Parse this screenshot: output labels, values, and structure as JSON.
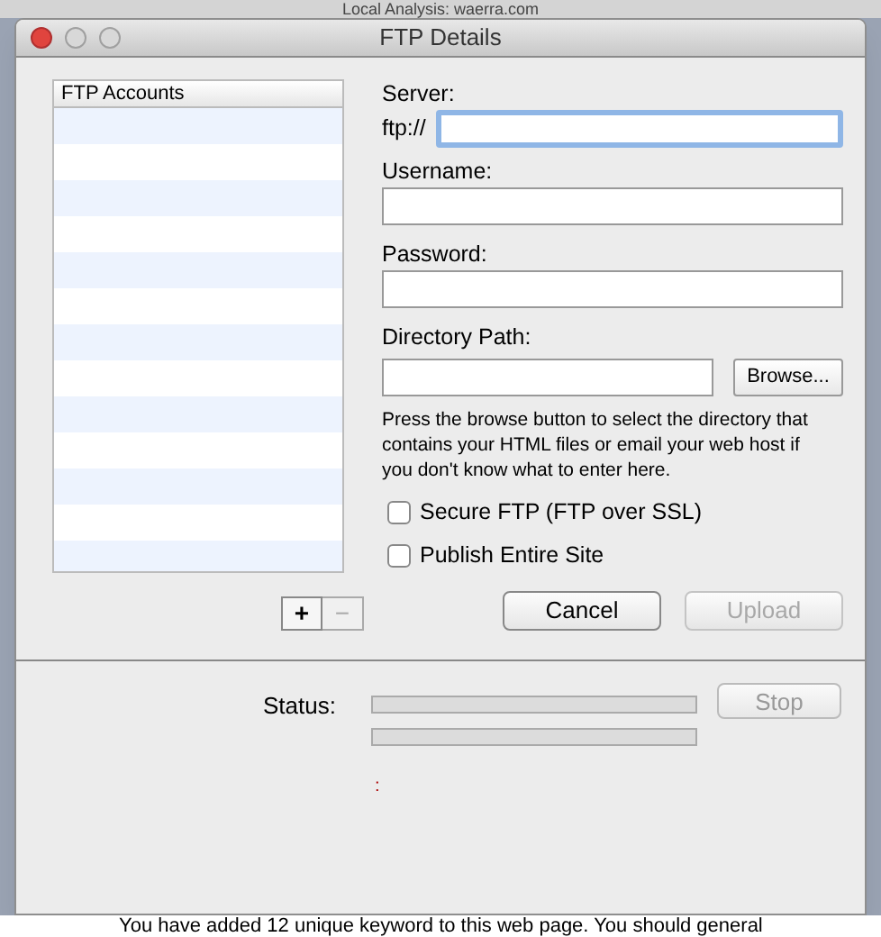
{
  "background": {
    "title": "Local Analysis: waerra.com",
    "message": "You have added 12 unique keyword to this web page. You should general"
  },
  "window": {
    "title": "FTP Details"
  },
  "accounts": {
    "header": "FTP Accounts",
    "add": "+",
    "remove": "−",
    "remove_disabled": true
  },
  "server": {
    "label": "Server:",
    "prefix": "ftp://",
    "focused": true
  },
  "username": {
    "label": "Username:"
  },
  "password": {
    "label": "Password:"
  },
  "directory": {
    "label": "Directory Path:",
    "browse": "Browse..."
  },
  "help": "Press the browse button to select the directory that contains your HTML files or email your web host if you don't know what to enter here.",
  "options": [
    {
      "label": "Secure FTP (FTP over SSL)",
      "checked": false
    },
    {
      "label": "Publish Entire Site",
      "checked": false
    }
  ],
  "buttons": [
    {
      "label": "Cancel",
      "disabled": false
    },
    {
      "label": "Upload",
      "disabled": true
    }
  ],
  "status": {
    "label": "Status:",
    "bars": [
      {
        "level": 0
      },
      {
        "level": 0
      }
    ],
    "stop": "Stop",
    "stop_disabled": true,
    "message": ":"
  }
}
